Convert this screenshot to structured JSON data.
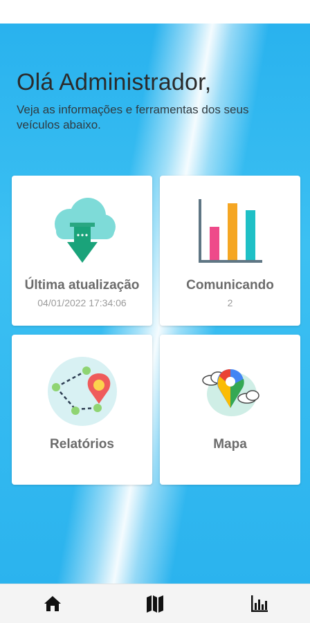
{
  "header": {
    "greeting": "Olá Administrador,",
    "subtitle": "Veja as informações e ferramentas dos seus veículos abaixo."
  },
  "cards": [
    {
      "title": "Última atualização",
      "value": "04/01/2022 17:34:06",
      "icon": "cloud-download-icon"
    },
    {
      "title": "Comunicando",
      "value": "2",
      "icon": "bar-chart-icon"
    },
    {
      "title": "Relatórios",
      "icon": "route-report-icon"
    },
    {
      "title": "Mapa",
      "icon": "google-maps-pin-icon"
    }
  ],
  "nav": {
    "items": [
      {
        "icon": "home-icon"
      },
      {
        "icon": "map-icon"
      },
      {
        "icon": "reports-chart-icon"
      }
    ]
  },
  "colors": {
    "background_blue": "#2bb3ee",
    "card_text": "#6b6b6b",
    "card_subtext": "#9a9a9a",
    "cloud_teal": "#7edbd8",
    "arrow_green": "#1aa37a",
    "bar_pink": "#ee4a8a",
    "bar_orange": "#f5a623",
    "bar_teal": "#1fc0c6"
  }
}
